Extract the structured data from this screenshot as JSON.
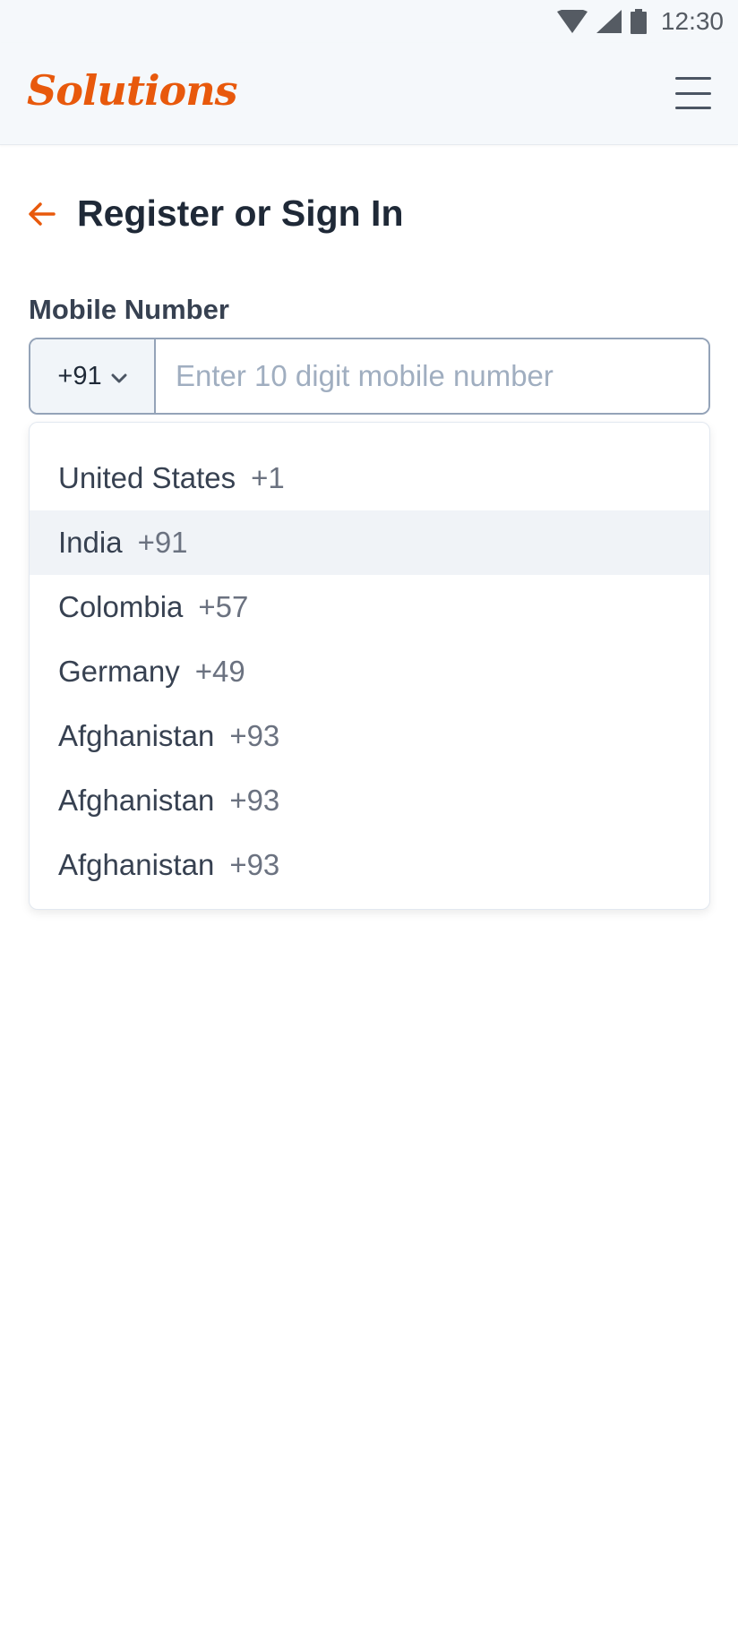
{
  "status_bar": {
    "time": "12:30",
    "icons": [
      "wifi-icon",
      "signal-icon",
      "battery-icon"
    ]
  },
  "header": {
    "logo_text": "Solutions",
    "menu_icon": "hamburger-menu-icon"
  },
  "page": {
    "title": "Register or Sign In",
    "back_icon": "arrow-left-icon"
  },
  "form": {
    "mobile_label": "Mobile Number",
    "country_code": "+91",
    "phone_value": "",
    "phone_placeholder": "Enter 10 digit mobile number"
  },
  "dropdown": {
    "selected_index": 1,
    "items": [
      {
        "name": "United States",
        "code": "+1"
      },
      {
        "name": "India",
        "code": "+91"
      },
      {
        "name": "Colombia",
        "code": "+57"
      },
      {
        "name": "Germany",
        "code": "+49"
      },
      {
        "name": "Afghanistan",
        "code": "+93"
      },
      {
        "name": "Afghanistan",
        "code": "+93"
      },
      {
        "name": "Afghanistan",
        "code": "+93"
      }
    ]
  },
  "colors": {
    "accent": "#e8590c",
    "header_bg": "#f5f8fb",
    "selected_row_bg": "#f0f3f7",
    "text_primary": "#1f2937",
    "text_muted": "#6b7280"
  }
}
